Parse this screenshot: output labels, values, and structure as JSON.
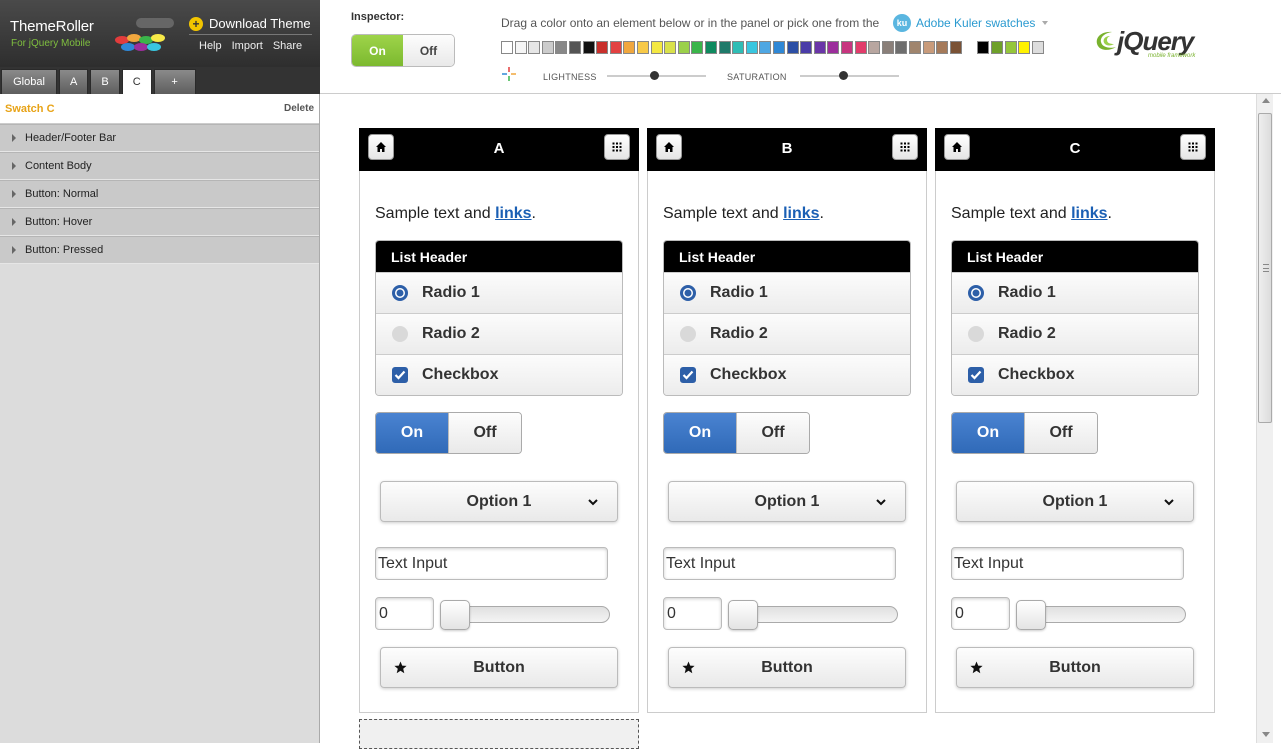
{
  "brand": {
    "title": "ThemeRoller",
    "subtitle": "For jQuery Mobile",
    "download_label": "Download Theme",
    "links": [
      "Help",
      "Import",
      "Share"
    ]
  },
  "tabs": [
    {
      "label": "Global",
      "active": false
    },
    {
      "label": "A",
      "active": false
    },
    {
      "label": "B",
      "active": false
    },
    {
      "label": "C",
      "active": true
    },
    {
      "label": "+",
      "active": false
    }
  ],
  "panel": {
    "swatch_name": "Swatch C",
    "delete_label": "Delete",
    "sections": [
      "Header/Footer Bar",
      "Content Body",
      "Button: Normal",
      "Button: Hover",
      "Button: Pressed"
    ]
  },
  "toolbar": {
    "inspector_label": "Inspector:",
    "inspector_on": "On",
    "inspector_off": "Off",
    "drag_text": "Drag a color onto an element below or in the panel or pick one from the",
    "kuler_label": "Adobe Kuler swatches",
    "kuler_icon": "ku",
    "lightness_label": "LIGHTNESS",
    "saturation_label": "SATURATION",
    "lightness_value": 0.48,
    "saturation_value": 0.44,
    "logo_text": "jQuery",
    "logo_sub": "mobile framework",
    "swatch_colors": [
      "#ffffff",
      "#f5f5f5",
      "#e6e6e6",
      "#cccccc",
      "#888888",
      "#555555",
      "#111111",
      "#c9302c",
      "#e24141",
      "#f0a73e",
      "#f7c948",
      "#f4e842",
      "#d9e14b",
      "#9bd04a",
      "#3ab54a",
      "#0f8a5f",
      "#1f7a6a",
      "#2fbdb5",
      "#39c6df",
      "#4fa7e3",
      "#2f88d6",
      "#2c4fa5",
      "#4a3ca8",
      "#6a36a8",
      "#9c2e9c",
      "#c7357f",
      "#e23c6b",
      "#b8a6a0",
      "#8a7f79",
      "#6e6e6e",
      "#a0856e",
      "#c89b7b",
      "#a57a5a",
      "#7a5235",
      "#000000",
      "#6ea02a",
      "#95c63b",
      "#fff200",
      "#dddddd"
    ]
  },
  "cards": [
    {
      "title": "A"
    },
    {
      "title": "B"
    },
    {
      "title": "C"
    }
  ],
  "preview": {
    "sample_text": "Sample text and ",
    "sample_link": "links",
    "sample_end": ".",
    "list_header": "List Header",
    "radio1": "Radio 1",
    "radio2": "Radio 2",
    "checkbox": "Checkbox",
    "flip_on": "On",
    "flip_off": "Off",
    "select_value": "Option 1",
    "text_input_value": "Text Input",
    "slider_value": "0",
    "slider_fraction": 0,
    "button_label": "Button"
  },
  "colors": {
    "accent_blue": "#3a72c4",
    "inspector_green": "#8ec63f",
    "swatch_orange": "#e8a317"
  }
}
